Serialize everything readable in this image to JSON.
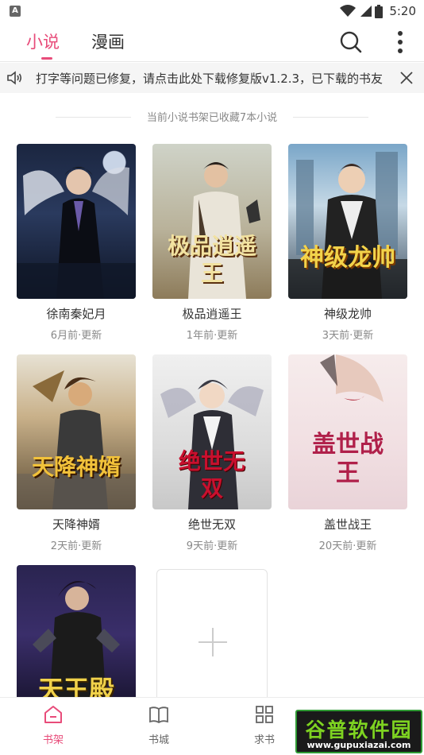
{
  "status_bar": {
    "notification_letter": "A",
    "time": "5:20"
  },
  "header": {
    "tabs": [
      {
        "label": "小说",
        "active": true
      },
      {
        "label": "漫画",
        "active": false
      }
    ],
    "icons": {
      "search": "search-icon",
      "more": "more-vert-icon"
    }
  },
  "notice": {
    "text": "打字等问题已修复，请点击此处下载修复版v1.2.3，已下载的书友",
    "icons": {
      "speaker": "speaker-icon",
      "close": "close-icon"
    }
  },
  "shelf": {
    "info": "当前小说书架已收藏7本小说",
    "books": [
      {
        "title": "徐南秦妃月",
        "update": "6月前·更新",
        "cover_text": ""
      },
      {
        "title": "极品逍遥王",
        "update": "1年前·更新",
        "cover_text": "极品逍遥王"
      },
      {
        "title": "神级龙帅",
        "update": "3天前·更新",
        "cover_text": "神级龙帅"
      },
      {
        "title": "天降神婿",
        "update": "2天前·更新",
        "cover_text": "天降神婿"
      },
      {
        "title": "绝世无双",
        "update": "9天前·更新",
        "cover_text": "绝世无双"
      },
      {
        "title": "盖世战王",
        "update": "20天前·更新",
        "cover_text": "盖世战王"
      },
      {
        "title": "",
        "update": "",
        "cover_text": "天王殿"
      }
    ],
    "add_icon": "plus-icon"
  },
  "bottom_nav": {
    "items": [
      {
        "label": "书架",
        "icon": "bookshelf-icon",
        "active": true
      },
      {
        "label": "书城",
        "icon": "book-icon",
        "active": false
      },
      {
        "label": "求书",
        "icon": "grid-icon",
        "active": false
      }
    ]
  },
  "watermark": {
    "title": "谷普软件园",
    "url": "www.gupuxiazai.com"
  },
  "colors": {
    "accent": "#e84c7a",
    "text": "#333333",
    "muted": "#888888"
  }
}
